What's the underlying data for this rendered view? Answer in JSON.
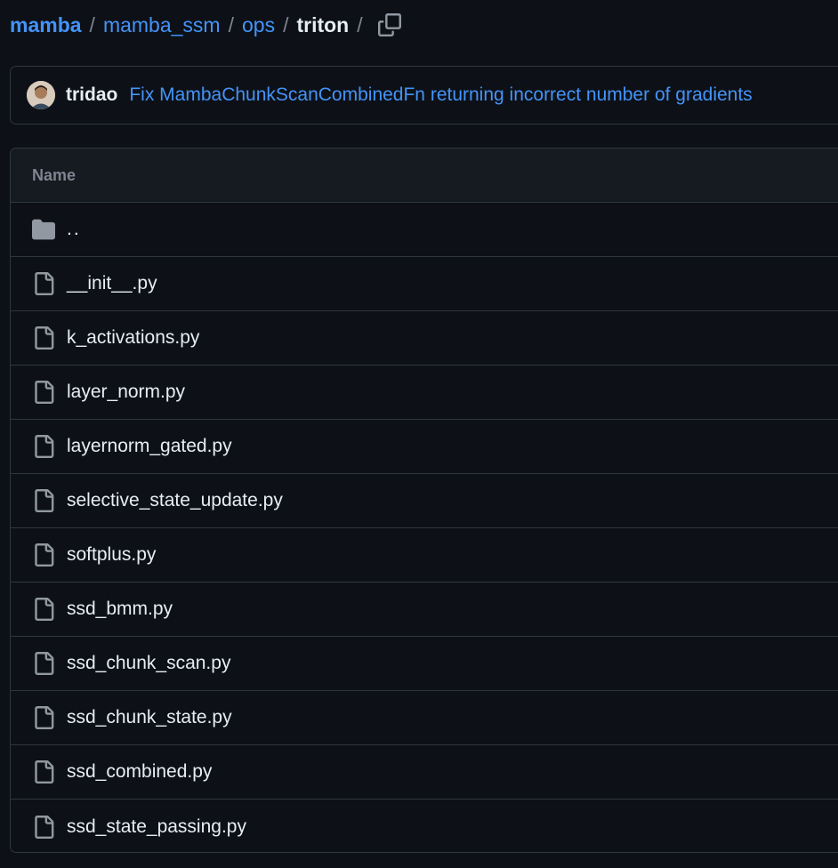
{
  "breadcrumb": {
    "items": [
      "mamba",
      "mamba_ssm",
      "ops"
    ],
    "current": "triton",
    "separator": "/",
    "copy_icon": "copy-icon"
  },
  "commit": {
    "author": "tridao",
    "message": "Fix MambaChunkScanCombinedFn returning incorrect number of gradients"
  },
  "table": {
    "header": "Name",
    "parent_dir": "..",
    "files": [
      "__init__.py",
      "k_activations.py",
      "layer_norm.py",
      "layernorm_gated.py",
      "selective_state_update.py",
      "softplus.py",
      "ssd_bmm.py",
      "ssd_chunk_scan.py",
      "ssd_chunk_state.py",
      "ssd_combined.py",
      "ssd_state_passing.py"
    ]
  },
  "colors": {
    "background": "#0d1117",
    "link": "#4493f8",
    "border": "#30363d",
    "header_bg": "#161b22",
    "muted": "#7d8590",
    "text": "#e6edf3"
  }
}
